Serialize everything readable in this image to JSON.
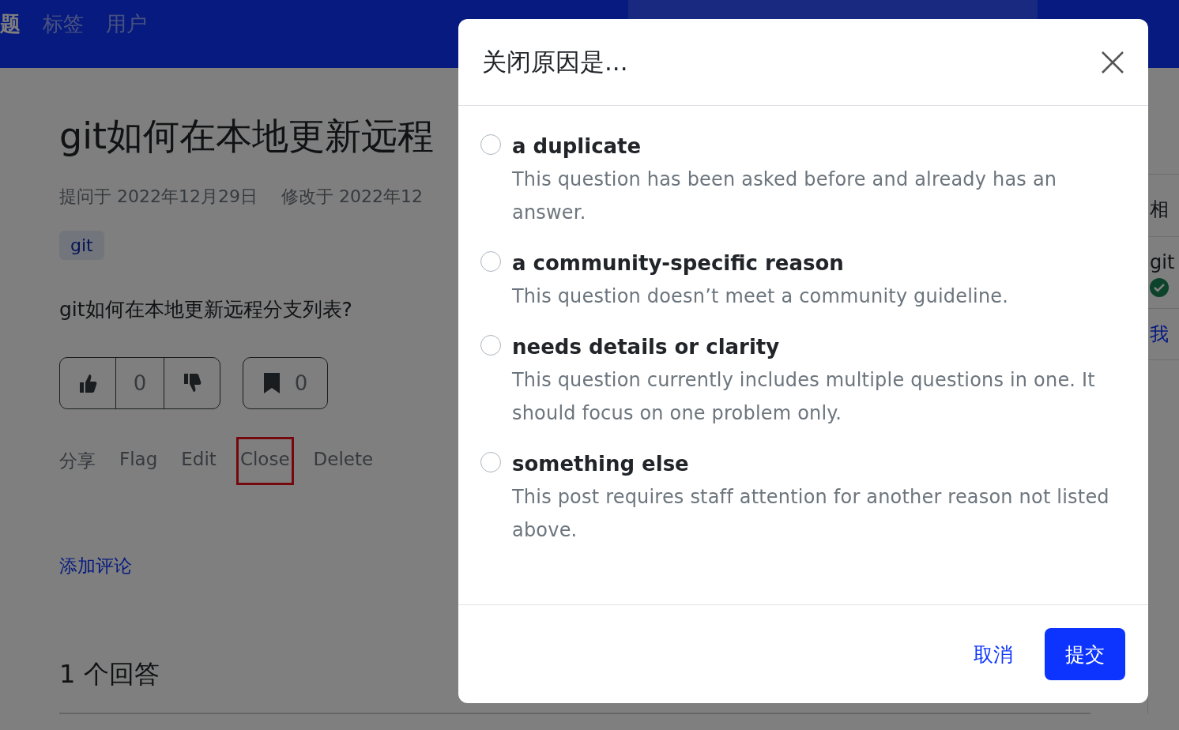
{
  "navbar": {
    "items": [
      {
        "label": "题",
        "selected": true
      },
      {
        "label": "标签",
        "selected": false
      },
      {
        "label": "用户",
        "selected": false
      }
    ]
  },
  "question": {
    "title": "git如何在本地更新远程",
    "asked": "提问于 2022年12月29日",
    "modified": "修改于 2022年12",
    "tags": [
      "git"
    ],
    "body": "git如何在本地更新远程分支列表?",
    "votes": "0",
    "bookmarks": "0",
    "actions": [
      {
        "label": "分享",
        "highlighted": false
      },
      {
        "label": "Flag",
        "highlighted": false
      },
      {
        "label": "Edit",
        "highlighted": false
      },
      {
        "label": "Close",
        "highlighted": true
      },
      {
        "label": "Delete",
        "highlighted": false
      }
    ],
    "add_comment": "添加评论",
    "answers_heading": "1 个回答"
  },
  "sidebar": {
    "heading": "相",
    "item": "git",
    "link": "我"
  },
  "dialog": {
    "title": "关闭原因是...",
    "options": [
      {
        "label": "a duplicate",
        "description": "This question has been asked before and already has an answer.",
        "selected": false
      },
      {
        "label": "a community-specific reason",
        "description": "This question doesn’t meet a community guideline.",
        "selected": false
      },
      {
        "label": "needs details or clarity",
        "description": "This question currently includes multiple questions in one. It should focus on one problem only.",
        "selected": false
      },
      {
        "label": "something else",
        "description": "This post requires staff attention for another reason not listed above.",
        "selected": false
      }
    ],
    "cancel": "取消",
    "submit": "提交"
  }
}
